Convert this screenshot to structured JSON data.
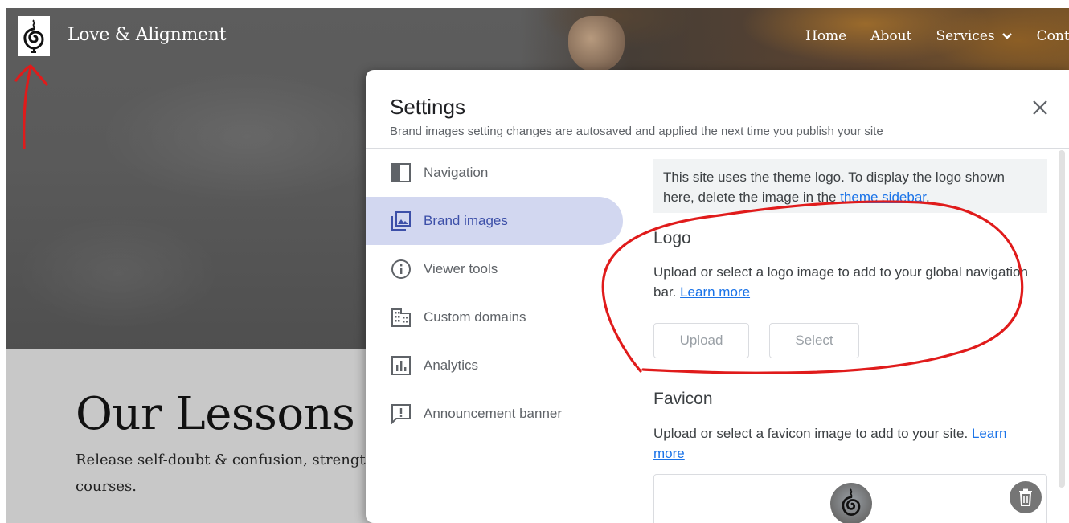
{
  "site": {
    "title": "Love & Alignment",
    "nav": [
      "Home",
      "About",
      "Services",
      "Conta"
    ],
    "lessons_title": "Our Lessons",
    "lessons_subtitle": "Release self-doubt & confusion, strength courses."
  },
  "dialog": {
    "title": "Settings",
    "subtitle": "Brand images setting changes are autosaved and applied the next time you publish your site",
    "sidebar": [
      {
        "label": "Navigation",
        "icon": "navigation-panel-icon"
      },
      {
        "label": "Brand images",
        "icon": "image-icon",
        "active": true
      },
      {
        "label": "Viewer tools",
        "icon": "info-icon"
      },
      {
        "label": "Custom domains",
        "icon": "building-icon"
      },
      {
        "label": "Analytics",
        "icon": "bar-chart-icon"
      },
      {
        "label": "Announcement banner",
        "icon": "announcement-icon"
      }
    ],
    "notice": {
      "text_before": "This site uses the theme logo. To display the logo shown here, delete the image in the ",
      "link": "theme sidebar",
      "text_after": "."
    },
    "logo": {
      "title": "Logo",
      "description": "Upload or select a logo image to add to your global navigation bar.",
      "learn_more": "Learn more",
      "upload_label": "Upload",
      "select_label": "Select"
    },
    "favicon": {
      "title": "Favicon",
      "description": "Upload or select a favicon image to add to your site.",
      "learn_more": "Learn more"
    }
  },
  "colors": {
    "accent": "#1a73e8",
    "active_bg": "#d2d7f0",
    "active_text": "#3c4fa8",
    "annotation_red": "#e01b1b"
  }
}
